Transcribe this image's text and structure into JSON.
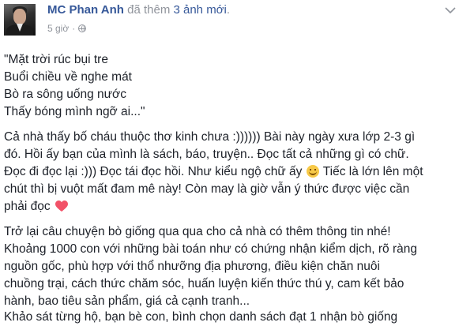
{
  "post": {
    "author": "MC Phan Anh",
    "action_text": "đã thêm",
    "photos_link": "3 ảnh mới",
    "period": ".",
    "timestamp": "5 giờ",
    "separator": "·",
    "privacy_icon": "globe-icon",
    "menu_icon": "chevron-down-icon"
  },
  "content": {
    "poem": [
      "\"Mặt trời rúc bụi tre",
      "Buổi chiều về nghe mát",
      "Bò ra sông uống nước",
      "Thấy bóng mình ngỡ ai...\""
    ],
    "paragraph2": {
      "line1": "Cả nhà thấy bố cháu thuộc thơ kinh chưa :)))))) Bài này ngày xưa lớp 2-3 gì",
      "line2": "đó. Hồi ấy bạn của mình là sách, báo, truyện.. Đọc tất cả những gì có chữ.",
      "line3_before_emoji": "Đọc đi đọc lại :))) Đọc tái đọc hồi. Như kiểu ngộ chữ ấy",
      "line3_after_emoji": " Tiếc là lớn lên một",
      "line4": "chút thì bị vuột mất đam mê này! Còn may là giờ vẫn ý thức được việc cần",
      "line5": "phải đọc",
      "smile_emoji": "smile-emoji",
      "heart_emoji": "heart-icon"
    },
    "paragraph3": [
      "Trở lại câu chuyện bò giống qua qua cho cả nhà có thêm thông tin nhé!",
      "Khoảng 1000 con với những bài toán như có chứng nhận kiểm dịch, rõ ràng",
      "nguồn gốc, phù hợp với thổ nhưỡng địa phương, điều kiện chăn nuôi",
      "chuồng trại, cách thức chăm sóc, huấn luyện kiến thức thú y, cam kết bảo",
      "hành, bao tiêu sản phẩm, giá cả cạnh tranh..."
    ],
    "cutoff_line": "Khảo sát từng hộ, bạn bè con, bình chọn danh sách đạt 1 nhận bò giống"
  },
  "colors": {
    "link": "#365899",
    "meta": "#90949c",
    "text": "#1d2129",
    "heart": "#f25268"
  }
}
